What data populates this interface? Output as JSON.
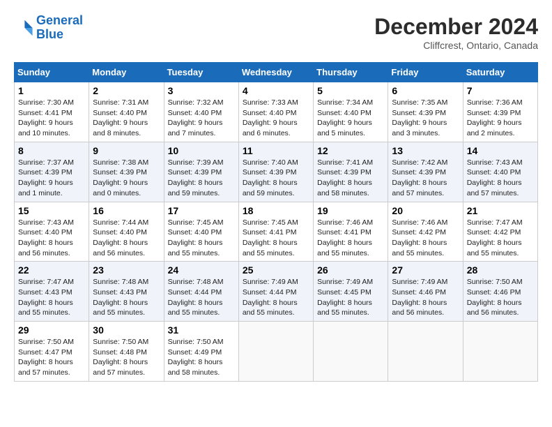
{
  "header": {
    "logo_line1": "General",
    "logo_line2": "Blue",
    "title": "December 2024",
    "subtitle": "Cliffcrest, Ontario, Canada"
  },
  "weekdays": [
    "Sunday",
    "Monday",
    "Tuesday",
    "Wednesday",
    "Thursday",
    "Friday",
    "Saturday"
  ],
  "weeks": [
    [
      {
        "day": "1",
        "sunrise": "7:30 AM",
        "sunset": "4:41 PM",
        "daylight": "9 hours and 10 minutes."
      },
      {
        "day": "2",
        "sunrise": "7:31 AM",
        "sunset": "4:40 PM",
        "daylight": "9 hours and 8 minutes."
      },
      {
        "day": "3",
        "sunrise": "7:32 AM",
        "sunset": "4:40 PM",
        "daylight": "9 hours and 7 minutes."
      },
      {
        "day": "4",
        "sunrise": "7:33 AM",
        "sunset": "4:40 PM",
        "daylight": "9 hours and 6 minutes."
      },
      {
        "day": "5",
        "sunrise": "7:34 AM",
        "sunset": "4:40 PM",
        "daylight": "9 hours and 5 minutes."
      },
      {
        "day": "6",
        "sunrise": "7:35 AM",
        "sunset": "4:39 PM",
        "daylight": "9 hours and 3 minutes."
      },
      {
        "day": "7",
        "sunrise": "7:36 AM",
        "sunset": "4:39 PM",
        "daylight": "9 hours and 2 minutes."
      }
    ],
    [
      {
        "day": "8",
        "sunrise": "7:37 AM",
        "sunset": "4:39 PM",
        "daylight": "9 hours and 1 minute."
      },
      {
        "day": "9",
        "sunrise": "7:38 AM",
        "sunset": "4:39 PM",
        "daylight": "9 hours and 0 minutes."
      },
      {
        "day": "10",
        "sunrise": "7:39 AM",
        "sunset": "4:39 PM",
        "daylight": "8 hours and 59 minutes."
      },
      {
        "day": "11",
        "sunrise": "7:40 AM",
        "sunset": "4:39 PM",
        "daylight": "8 hours and 59 minutes."
      },
      {
        "day": "12",
        "sunrise": "7:41 AM",
        "sunset": "4:39 PM",
        "daylight": "8 hours and 58 minutes."
      },
      {
        "day": "13",
        "sunrise": "7:42 AM",
        "sunset": "4:39 PM",
        "daylight": "8 hours and 57 minutes."
      },
      {
        "day": "14",
        "sunrise": "7:43 AM",
        "sunset": "4:40 PM",
        "daylight": "8 hours and 57 minutes."
      }
    ],
    [
      {
        "day": "15",
        "sunrise": "7:43 AM",
        "sunset": "4:40 PM",
        "daylight": "8 hours and 56 minutes."
      },
      {
        "day": "16",
        "sunrise": "7:44 AM",
        "sunset": "4:40 PM",
        "daylight": "8 hours and 56 minutes."
      },
      {
        "day": "17",
        "sunrise": "7:45 AM",
        "sunset": "4:40 PM",
        "daylight": "8 hours and 55 minutes."
      },
      {
        "day": "18",
        "sunrise": "7:45 AM",
        "sunset": "4:41 PM",
        "daylight": "8 hours and 55 minutes."
      },
      {
        "day": "19",
        "sunrise": "7:46 AM",
        "sunset": "4:41 PM",
        "daylight": "8 hours and 55 minutes."
      },
      {
        "day": "20",
        "sunrise": "7:46 AM",
        "sunset": "4:42 PM",
        "daylight": "8 hours and 55 minutes."
      },
      {
        "day": "21",
        "sunrise": "7:47 AM",
        "sunset": "4:42 PM",
        "daylight": "8 hours and 55 minutes."
      }
    ],
    [
      {
        "day": "22",
        "sunrise": "7:47 AM",
        "sunset": "4:43 PM",
        "daylight": "8 hours and 55 minutes."
      },
      {
        "day": "23",
        "sunrise": "7:48 AM",
        "sunset": "4:43 PM",
        "daylight": "8 hours and 55 minutes."
      },
      {
        "day": "24",
        "sunrise": "7:48 AM",
        "sunset": "4:44 PM",
        "daylight": "8 hours and 55 minutes."
      },
      {
        "day": "25",
        "sunrise": "7:49 AM",
        "sunset": "4:44 PM",
        "daylight": "8 hours and 55 minutes."
      },
      {
        "day": "26",
        "sunrise": "7:49 AM",
        "sunset": "4:45 PM",
        "daylight": "8 hours and 55 minutes."
      },
      {
        "day": "27",
        "sunrise": "7:49 AM",
        "sunset": "4:46 PM",
        "daylight": "8 hours and 56 minutes."
      },
      {
        "day": "28",
        "sunrise": "7:50 AM",
        "sunset": "4:46 PM",
        "daylight": "8 hours and 56 minutes."
      }
    ],
    [
      {
        "day": "29",
        "sunrise": "7:50 AM",
        "sunset": "4:47 PM",
        "daylight": "8 hours and 57 minutes."
      },
      {
        "day": "30",
        "sunrise": "7:50 AM",
        "sunset": "4:48 PM",
        "daylight": "8 hours and 57 minutes."
      },
      {
        "day": "31",
        "sunrise": "7:50 AM",
        "sunset": "4:49 PM",
        "daylight": "8 hours and 58 minutes."
      },
      null,
      null,
      null,
      null
    ]
  ]
}
